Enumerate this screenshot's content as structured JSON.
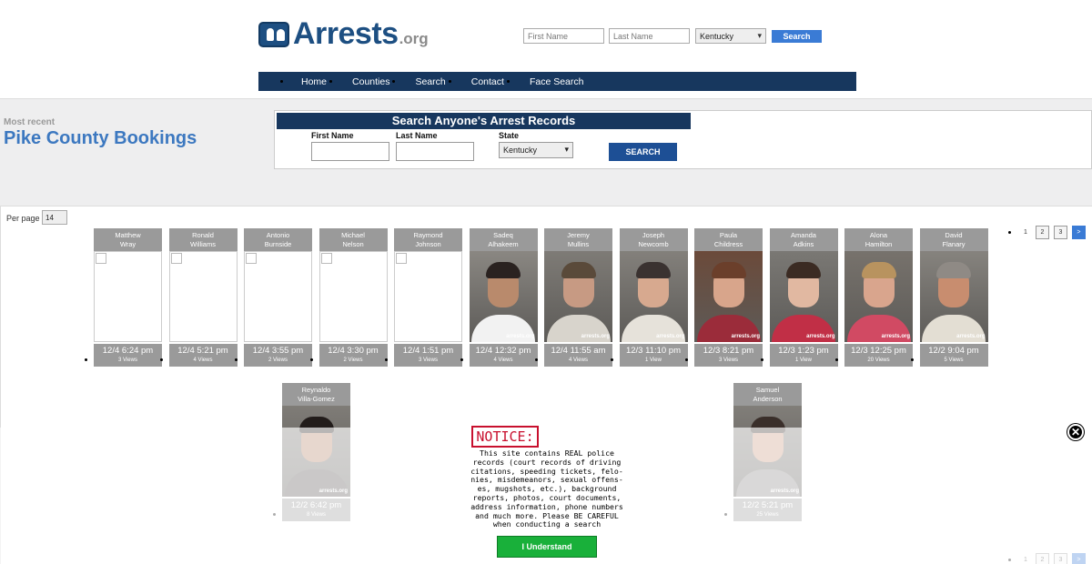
{
  "header": {
    "logo_text": "Arrests",
    "logo_suffix": ".org",
    "first_name_placeholder": "First Name",
    "last_name_placeholder": "Last Name",
    "state_value": "Kentucky",
    "search_label": "Search"
  },
  "nav": {
    "items": [
      "Home",
      "Counties",
      "Search",
      "Contact",
      "Face Search"
    ]
  },
  "page": {
    "subtitle": "Most recent",
    "title": "Pike County Bookings"
  },
  "search_box": {
    "heading": "Search Anyone's Arrest Records",
    "first_name_label": "First Name",
    "last_name_label": "Last Name",
    "state_label": "State",
    "state_value": "Kentucky",
    "button_label": "SEARCH"
  },
  "listing": {
    "per_page_label": "Per page",
    "per_page_value": "14",
    "pages": [
      "1",
      "2",
      "3",
      ">"
    ]
  },
  "bookings": [
    {
      "first": "Matthew",
      "last": "Wray",
      "time": "12/4 6:24 pm",
      "views": "3 Views",
      "photo": "broken"
    },
    {
      "first": "Ronald",
      "last": "Williams",
      "time": "12/4 5:21 pm",
      "views": "4 Views",
      "photo": "broken"
    },
    {
      "first": "Antonio",
      "last": "Burnside",
      "time": "12/4 3:55 pm",
      "views": "2 Views",
      "photo": "broken"
    },
    {
      "first": "Michael",
      "last": "Nelson",
      "time": "12/4 3:30 pm",
      "views": "2 Views",
      "photo": "broken"
    },
    {
      "first": "Raymond",
      "last": "Johnson",
      "time": "12/4 1:51 pm",
      "views": "3 Views",
      "photo": "broken"
    },
    {
      "first": "Sadeq",
      "last": "Alhakeem",
      "time": "12/4 12:32 pm",
      "views": "4 Views",
      "photo": "mugshot"
    },
    {
      "first": "Jeremy",
      "last": "Mullins",
      "time": "12/4 11:55 am",
      "views": "4 Views",
      "photo": "mugshot"
    },
    {
      "first": "Joseph",
      "last": "Newcomb",
      "time": "12/3 11:10 pm",
      "views": "1 View",
      "photo": "mugshot"
    },
    {
      "first": "Paula",
      "last": "Childress",
      "time": "12/3 8:21 pm",
      "views": "3 Views",
      "photo": "mugshot"
    },
    {
      "first": "Amanda",
      "last": "Adkins",
      "time": "12/3 1:23 pm",
      "views": "1 View",
      "photo": "mugshot"
    },
    {
      "first": "Alona",
      "last": "Hamilton",
      "time": "12/3 12:25 pm",
      "views": "20 Views",
      "photo": "mugshot"
    },
    {
      "first": "David",
      "last": "Flanary",
      "time": "12/2 9:04 pm",
      "views": "5 Views",
      "photo": "mugshot"
    },
    {
      "first": "Reynaldo",
      "last": "Villa-Gomez",
      "time": "12/2 6:42 pm",
      "views": "8 Views",
      "photo": "mugshot"
    },
    {
      "first": "Samuel",
      "last": "Anderson",
      "time": "12/2 5:21 pm",
      "views": "25 Views",
      "photo": "mugshot"
    }
  ],
  "notice": {
    "title": "NOTICE:",
    "lines": [
      "This site contains REAL police",
      "records (court records of driving",
      "citations, speeding tickets, felo-",
      "nies, misdemeanors, sexual offens-",
      "es, mugshots, etc.), background",
      "reports, photos, court documents,",
      "address information, phone numbers",
      "and much more. Please BE CAREFUL",
      "when conducting a search"
    ],
    "button_label": "I Understand",
    "close_symbol": "✕"
  },
  "watermark": "arrests.org",
  "colors": {
    "navy": "#17375e",
    "brand_blue": "#1d4f82",
    "title_blue": "#3c78c0",
    "button_blue": "#3a7bd5",
    "card_gray": "#9a9a9a",
    "notice_red": "#c8102e",
    "accept_green": "#19b03a"
  }
}
